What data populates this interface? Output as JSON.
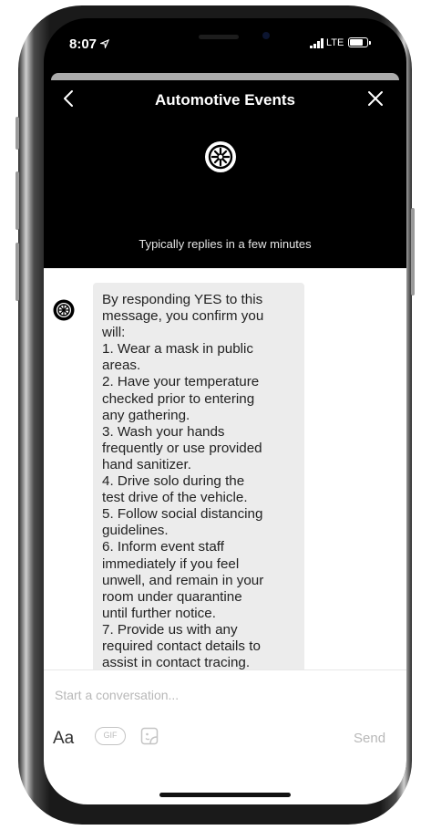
{
  "status_bar": {
    "time": "8:07",
    "network": "LTE"
  },
  "header": {
    "title": "Automotive Events",
    "subtitle": "Typically replies in a few minutes"
  },
  "message": {
    "lines": [
      "By responding YES to this",
      "message, you confirm you",
      "will:",
      "1. Wear a mask in public",
      "areas.",
      "2. Have your temperature",
      "checked prior to entering",
      "any gathering.",
      "3. Wash your hands",
      "frequently or use provided",
      "hand sanitizer.",
      "4. Drive solo during the",
      "test drive of the vehicle.",
      "5. Follow social distancing",
      "guidelines.",
      "6. Inform event staff",
      "immediately if you feel",
      "unwell, and remain in your",
      "room under quarantine",
      "until further notice.",
      "7. Provide us with any",
      "required contact details to",
      "assist in contact tracing."
    ]
  },
  "composer": {
    "placeholder": "Start a conversation...",
    "aa_label": "Aa",
    "gif_label": "GIF",
    "send_label": "Send"
  }
}
